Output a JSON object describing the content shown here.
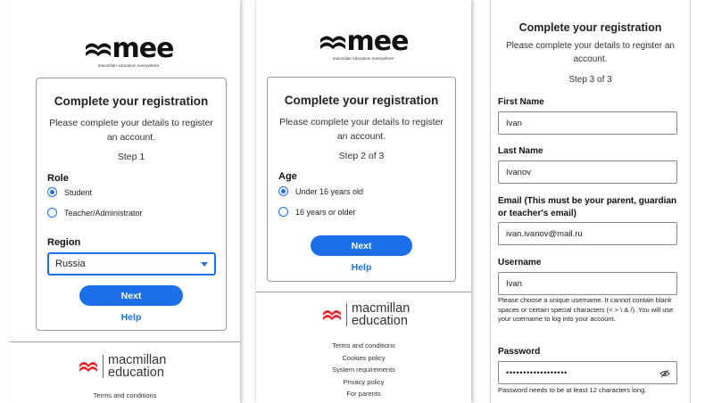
{
  "brand": {
    "wordmark": "mee",
    "tagline": "macmillan education everywhere",
    "publisher_line1": "macmillan",
    "publisher_line2": "education",
    "accent_color": "#1b6fe8",
    "logo_color": "#e8262d"
  },
  "step1": {
    "title": "Complete your registration",
    "subtitle": "Please complete your details to register an account.",
    "step": "Step 1",
    "role_label": "Role",
    "role_options": [
      "Student",
      "Teacher/Administrator"
    ],
    "role_selected": "Student",
    "region_label": "Region",
    "region_value": "Russia",
    "next": "Next",
    "help": "Help",
    "footer_links": [
      "Terms and conditions"
    ]
  },
  "step2": {
    "title": "Complete your registration",
    "subtitle": "Please complete your details to register an account.",
    "step": "Step 2 of 3",
    "age_label": "Age",
    "age_options": [
      "Under 16 years old",
      "16 years or older"
    ],
    "age_selected": "Under 16 years old",
    "next": "Next",
    "help": "Help",
    "footer_links": [
      "Terms and conditions",
      "Cookies policy",
      "System requirements",
      "Privacy policy",
      "For parents"
    ]
  },
  "step3": {
    "title": "Complete your registration",
    "subtitle": "Please complete your details to register an account.",
    "step": "Step 3 of 3",
    "first_name_label": "First Name",
    "first_name_value": "Ivan",
    "last_name_label": "Last Name",
    "last_name_value": "Ivanov",
    "email_label": "Email (This must be your parent, guardian or teacher's email)",
    "email_value": "ivan.ivanov@mail.ru",
    "username_label": "Username",
    "username_value": "Ivan",
    "username_hint": "Please choose a unique username. It cannot contain blank spaces or certain special characters (< > \\ & /). You will use your username to log into your account.",
    "password_label": "Password",
    "password_value": "••••••••••••••••••",
    "password_hint": "Password needs to be at least 12 characters long."
  }
}
